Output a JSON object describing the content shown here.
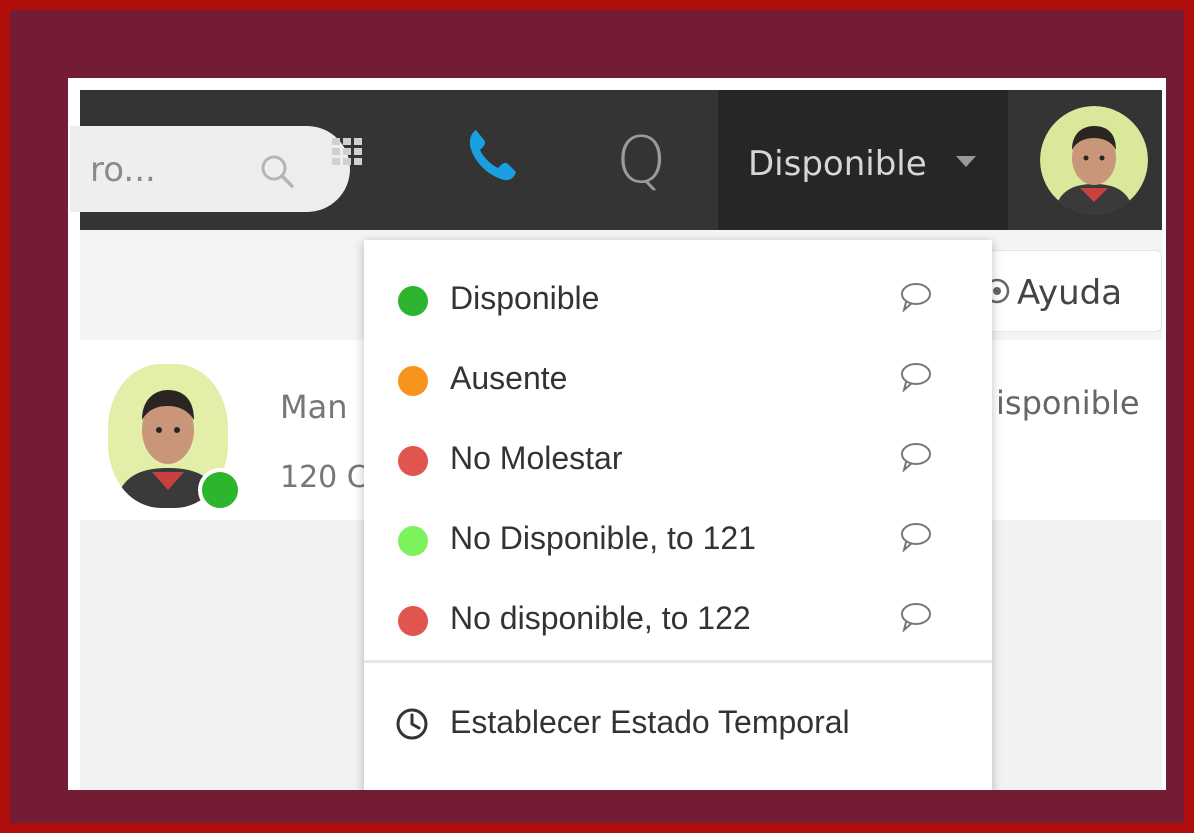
{
  "topbar": {
    "search_text": "ro...",
    "status_label": "Disponible"
  },
  "toolbar": {
    "help_label": "Ayuda"
  },
  "contact": {
    "name": "Man",
    "extension": "120 C",
    "status": "isponible"
  },
  "status_menu": {
    "items": [
      {
        "label": "Disponible",
        "color": "#2db52d"
      },
      {
        "label": "Ausente",
        "color": "#f7941d"
      },
      {
        "label": "No Molestar",
        "color": "#e0564e"
      },
      {
        "label": "No Disponible, to 121",
        "color": "#7ef25c"
      },
      {
        "label": "No disponible, to 122",
        "color": "#e0564e"
      }
    ],
    "temporary_status_label": "Establecer Estado Temporal"
  },
  "colors": {
    "topbar_bg": "#343434",
    "phone_accent": "#1a9fe0",
    "presence_available": "#2db52d"
  }
}
